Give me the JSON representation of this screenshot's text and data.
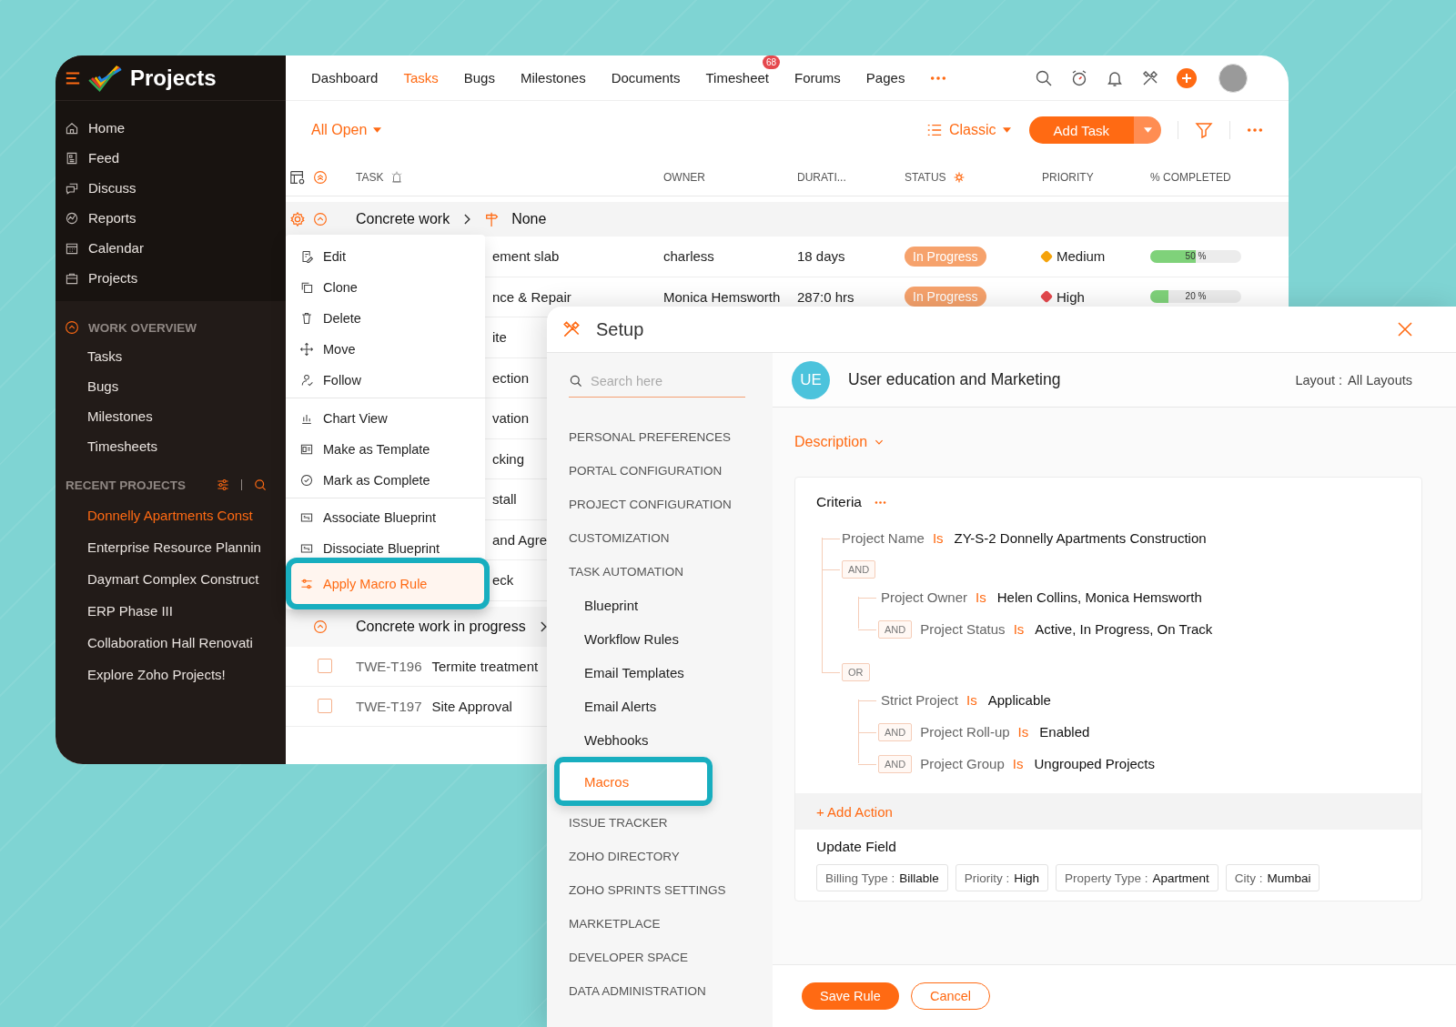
{
  "sidebar": {
    "brand": "Projects",
    "nav": [
      {
        "label": "Home"
      },
      {
        "label": "Feed"
      },
      {
        "label": "Discuss"
      },
      {
        "label": "Reports"
      },
      {
        "label": "Calendar"
      },
      {
        "label": "Projects"
      }
    ],
    "work_overview": {
      "title": "WORK OVERVIEW",
      "expanded": true,
      "items": [
        {
          "label": "Tasks"
        },
        {
          "label": "Bugs"
        },
        {
          "label": "Milestones"
        },
        {
          "label": "Timesheets"
        }
      ]
    },
    "recent_projects": {
      "title": "RECENT PROJECTS",
      "items": [
        {
          "label": "Donnelly Apartments Const",
          "selected": true
        },
        {
          "label": "Enterprise Resource Plannin",
          "selected": false
        },
        {
          "label": "Daymart Complex Construct",
          "selected": false
        },
        {
          "label": "ERP Phase III",
          "selected": false
        },
        {
          "label": "Collaboration Hall Renovati",
          "selected": false
        },
        {
          "label": "Explore Zoho Projects!",
          "selected": false
        }
      ]
    }
  },
  "topnav": {
    "tabs": [
      {
        "label": "Dashboard",
        "selected": false
      },
      {
        "label": "Tasks",
        "selected": true
      },
      {
        "label": "Bugs",
        "selected": false
      },
      {
        "label": "Milestones",
        "selected": false
      },
      {
        "label": "Documents",
        "selected": false
      },
      {
        "label": "Timesheet",
        "selected": false,
        "badge": "68"
      },
      {
        "label": "Forums",
        "selected": false
      },
      {
        "label": "Pages",
        "selected": false
      }
    ]
  },
  "toolbar": {
    "filter": "All Open",
    "view": "Classic",
    "add_button": "Add Task"
  },
  "table": {
    "columns": [
      "TASK",
      "OWNER",
      "DURATI...",
      "STATUS",
      "PRIORITY",
      "% COMPLETED"
    ],
    "groups": [
      {
        "name": "Concrete work",
        "expanded": true,
        "milestone": "None",
        "rows": [
          {
            "kind": "full",
            "task": "ement slab",
            "owner": "charless",
            "duration": "18 days",
            "status": "In Progress",
            "priority": "Medium",
            "color": "#f5a30b",
            "level": 0.5,
            "reading": "50 %"
          },
          {
            "kind": "full",
            "task": "nce & Repair",
            "owner": "Monica Hemsworth",
            "duration": "287:0 hrs",
            "status": "In Progress",
            "priority": "High",
            "color": "#e5484d",
            "level": 0.2,
            "reading": "20 %"
          },
          {
            "kind": "partial",
            "task": "ite"
          },
          {
            "kind": "partial",
            "task": "ection"
          },
          {
            "kind": "partial",
            "task": "vation"
          },
          {
            "kind": "partial",
            "task": "cking"
          },
          {
            "kind": "partial",
            "task": "stall"
          },
          {
            "kind": "partial",
            "task": "and Agre"
          },
          {
            "kind": "partial",
            "task": "eck"
          }
        ]
      },
      {
        "name": "Concrete work in progress",
        "expanded": true,
        "rows": [
          {
            "kind": "task",
            "id": "TWE-T196",
            "task": "Termite treatment",
            "checked": false
          },
          {
            "kind": "task",
            "id": "TWE-T197",
            "task": "Site Approval",
            "checked": false
          }
        ]
      }
    ]
  },
  "context_menu": {
    "sections": [
      [
        {
          "label": "Edit",
          "selected": false
        },
        {
          "label": "Clone",
          "selected": false
        },
        {
          "label": "Delete",
          "selected": false
        },
        {
          "label": "Move",
          "selected": false
        },
        {
          "label": "Follow",
          "selected": false
        }
      ],
      [
        {
          "label": "Chart View",
          "selected": false
        },
        {
          "label": "Make as Template",
          "selected": false
        },
        {
          "label": "Mark as Complete",
          "selected": false
        }
      ],
      [
        {
          "label": "Associate Blueprint",
          "selected": false
        },
        {
          "label": "Dissociate Blueprint",
          "selected": false
        },
        {
          "label": "Apply Macro Rule",
          "selected": true
        }
      ]
    ]
  },
  "setup": {
    "title": "Setup",
    "search": {
      "placeholder": "Search here"
    },
    "nav": [
      {
        "label": "PERSONAL PREFERENCES",
        "kind": "section",
        "selected": false
      },
      {
        "label": "PORTAL CONFIGURATION",
        "kind": "section",
        "selected": false
      },
      {
        "label": "PROJECT CONFIGURATION",
        "kind": "section",
        "selected": false
      },
      {
        "label": "CUSTOMIZATION",
        "kind": "section",
        "selected": false
      },
      {
        "label": "TASK AUTOMATION",
        "kind": "section",
        "selected": false
      },
      {
        "label": "Blueprint",
        "kind": "item",
        "selected": false
      },
      {
        "label": "Workflow Rules",
        "kind": "item",
        "selected": false
      },
      {
        "label": "Email Templates",
        "kind": "item",
        "selected": false
      },
      {
        "label": "Email Alerts",
        "kind": "item",
        "selected": false
      },
      {
        "label": "Webhooks",
        "kind": "item",
        "selected": false
      },
      {
        "label": "Macros",
        "kind": "item",
        "selected": true
      },
      {
        "label": "ISSUE TRACKER",
        "kind": "section",
        "selected": false
      },
      {
        "label": "ZOHO DIRECTORY",
        "kind": "section",
        "selected": false
      },
      {
        "label": "ZOHO SPRINTS SETTINGS",
        "kind": "section",
        "selected": false
      },
      {
        "label": "MARKETPLACE",
        "kind": "section",
        "selected": false
      },
      {
        "label": "DEVELOPER SPACE",
        "kind": "section",
        "selected": false
      },
      {
        "label": "DATA ADMINISTRATION",
        "kind": "section",
        "selected": false
      }
    ],
    "record": {
      "initials": "UE",
      "title": "User education and Marketing",
      "layout_label": "Layout :",
      "layout_value": "All Layouts"
    },
    "description": "Description",
    "criteria": {
      "title": "Criteria",
      "items": [
        {
          "kind": "condition",
          "field": "Project Name",
          "operator": "Is",
          "value": "ZY-S-2 Donnelly Apartments Construction"
        },
        {
          "kind": "group",
          "connector": "AND",
          "children": [
            {
              "field": "Project Owner",
              "operator": "Is",
              "value": "Helen Collins, Monica Hemsworth"
            },
            {
              "connector": "AND",
              "field": "Project Status",
              "operator": "Is",
              "value": "Active, In Progress, On Track"
            }
          ]
        },
        {
          "kind": "group",
          "connector": "OR",
          "children": [
            {
              "field": "Strict Project",
              "operator": "Is",
              "value": "Applicable"
            },
            {
              "connector": "AND",
              "field": "Project Roll-up",
              "operator": "Is",
              "value": "Enabled"
            },
            {
              "connector": "AND",
              "field": "Project Group",
              "operator": "Is",
              "value": "Ungrouped Projects"
            }
          ]
        }
      ]
    },
    "add_action": "+ Add Action",
    "update_field": {
      "title": "Update Field",
      "fields": [
        {
          "name": "Billing Type :",
          "value": "Billable"
        },
        {
          "name": "Priority :",
          "value": "High"
        },
        {
          "name": "Property Type :",
          "value": "Apartment"
        },
        {
          "name": "City :",
          "value": "Mumbai"
        }
      ]
    },
    "buttons": {
      "save": "Save Rule",
      "cancel": "Cancel"
    }
  }
}
